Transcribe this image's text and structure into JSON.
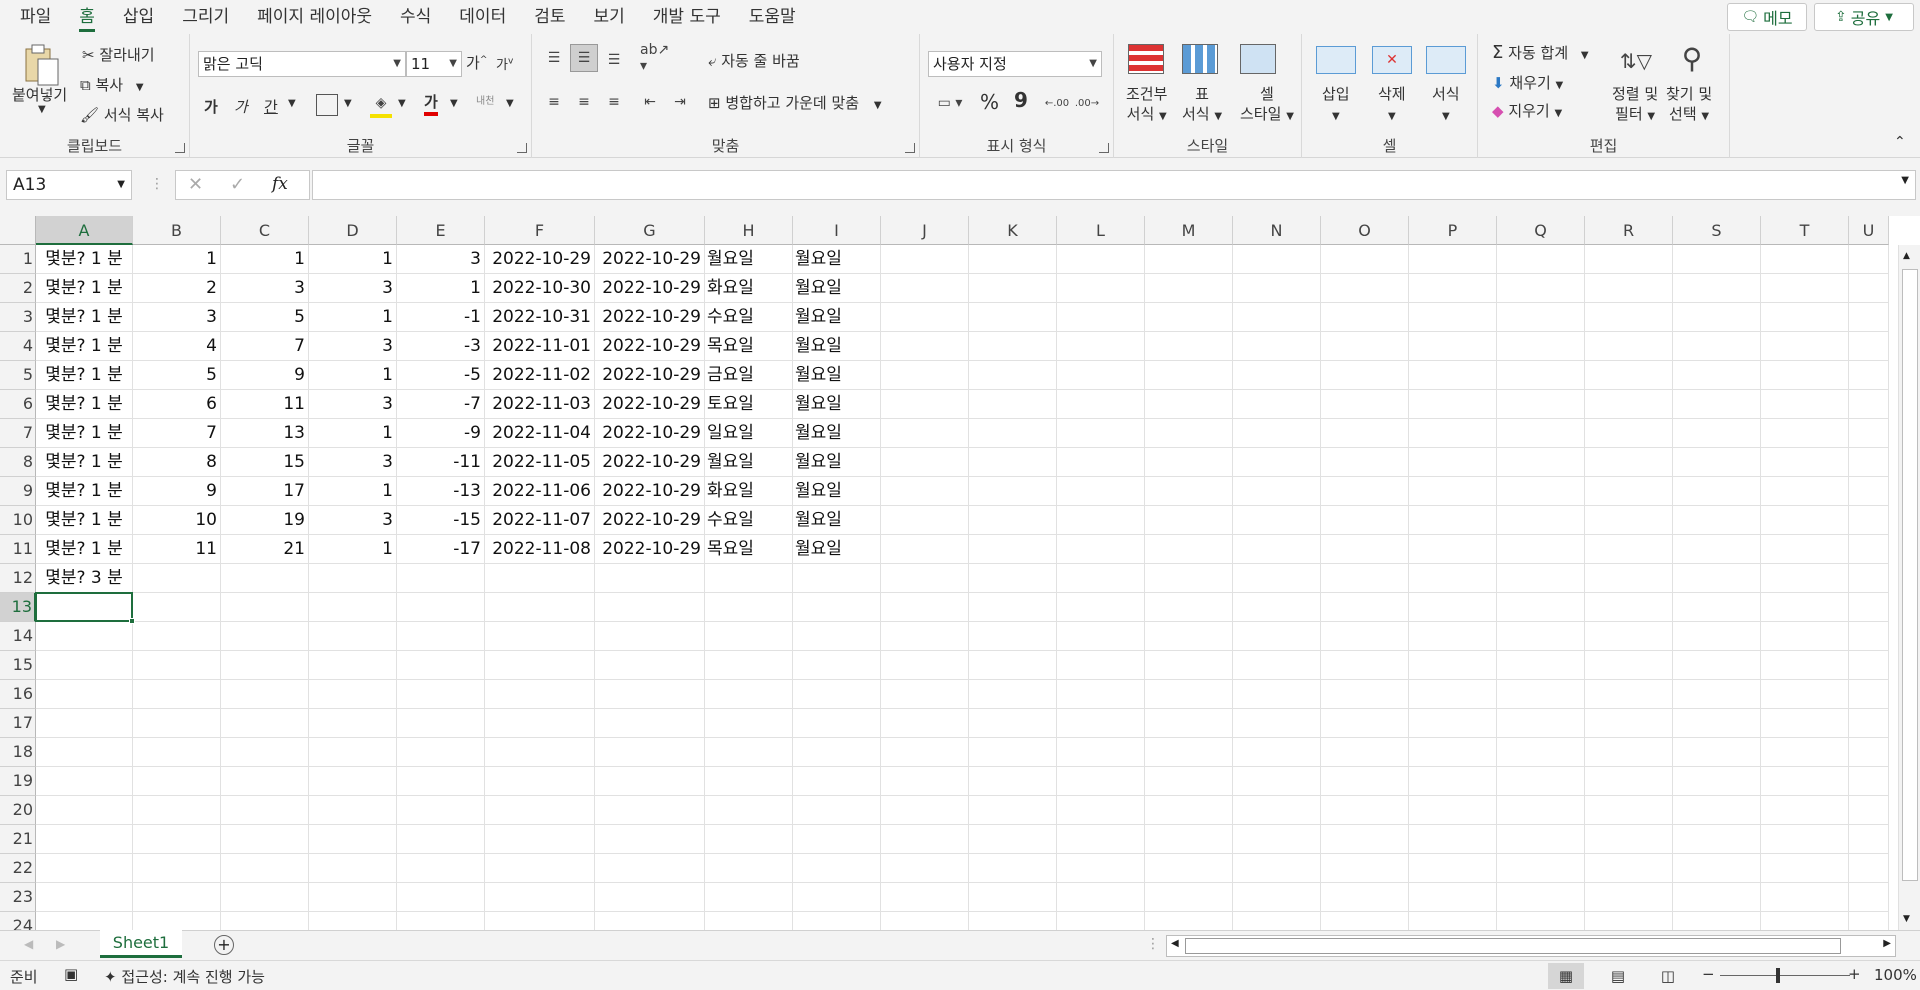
{
  "menu": {
    "tabs": [
      "파일",
      "홈",
      "삽입",
      "그리기",
      "페이지 레이아웃",
      "수식",
      "데이터",
      "검토",
      "보기",
      "개발 도구",
      "도움말"
    ],
    "active_index": 1
  },
  "topright": {
    "memo_label": "메모",
    "share_label": "공유"
  },
  "ribbon": {
    "clipboard": {
      "label": "클립보드",
      "paste": "붙여넣기",
      "cut": "잘라내기",
      "copy": "복사",
      "format_painter": "서식 복사"
    },
    "font": {
      "label": "글꼴",
      "font_name": "맑은 고딕",
      "font_size": "11",
      "grow": "가",
      "shrink": "가",
      "bold": "가",
      "italic": "가",
      "underline": "간",
      "font_color_glyph": "가",
      "phonetic": "내천"
    },
    "alignment": {
      "label": "맞춤",
      "wrap": "자동 줄 바꿈",
      "merge": "병합하고 가운데 맞춤"
    },
    "number": {
      "label": "표시 형식",
      "format": "사용자 지정",
      "percent": "%",
      "comma": "9"
    },
    "styles": {
      "label": "스타일",
      "conditional_line1": "조건부",
      "conditional_line2": "서식",
      "table_line1": "표",
      "table_line2": "서식",
      "cell_line1": "셀",
      "cell_line2": "스타일"
    },
    "cells": {
      "label": "셀",
      "insert": "삽입",
      "delete": "삭제",
      "format": "서식"
    },
    "editing": {
      "label": "편집",
      "autosum": "자동 합계",
      "fill": "채우기",
      "clear": "지우기",
      "sort_line1": "정렬 및",
      "sort_line2": "필터",
      "find_line1": "찾기 및",
      "find_line2": "선택"
    }
  },
  "formula_bar": {
    "name_box": "A13",
    "fx": "fx",
    "formula": ""
  },
  "sheet": {
    "columns": [
      "A",
      "B",
      "C",
      "D",
      "E",
      "F",
      "G",
      "H",
      "I",
      "J",
      "K",
      "L",
      "M",
      "N",
      "O",
      "P",
      "Q",
      "R",
      "S",
      "T",
      "U"
    ],
    "row_count": 24,
    "rows": [
      [
        "몇분? 1 분",
        "1",
        "1",
        "1",
        "3",
        "2022-10-29",
        "2022-10-29",
        "월요일",
        "월요일"
      ],
      [
        "몇분? 1 분",
        "2",
        "3",
        "3",
        "1",
        "2022-10-30",
        "2022-10-29",
        "화요일",
        "월요일"
      ],
      [
        "몇분? 1 분",
        "3",
        "5",
        "1",
        "-1",
        "2022-10-31",
        "2022-10-29",
        "수요일",
        "월요일"
      ],
      [
        "몇분? 1 분",
        "4",
        "7",
        "3",
        "-3",
        "2022-11-01",
        "2022-10-29",
        "목요일",
        "월요일"
      ],
      [
        "몇분? 1 분",
        "5",
        "9",
        "1",
        "-5",
        "2022-11-02",
        "2022-10-29",
        "금요일",
        "월요일"
      ],
      [
        "몇분? 1 분",
        "6",
        "11",
        "3",
        "-7",
        "2022-11-03",
        "2022-10-29",
        "토요일",
        "월요일"
      ],
      [
        "몇분? 1 분",
        "7",
        "13",
        "1",
        "-9",
        "2022-11-04",
        "2022-10-29",
        "일요일",
        "월요일"
      ],
      [
        "몇분? 1 분",
        "8",
        "15",
        "3",
        "-11",
        "2022-11-05",
        "2022-10-29",
        "월요일",
        "월요일"
      ],
      [
        "몇분? 1 분",
        "9",
        "17",
        "1",
        "-13",
        "2022-11-06",
        "2022-10-29",
        "화요일",
        "월요일"
      ],
      [
        "몇분? 1 분",
        "10",
        "19",
        "3",
        "-15",
        "2022-11-07",
        "2022-10-29",
        "수요일",
        "월요일"
      ],
      [
        "몇분? 1 분",
        "11",
        "21",
        "1",
        "-17",
        "2022-11-08",
        "2022-10-29",
        "목요일",
        "월요일"
      ],
      [
        "몇분? 3 분"
      ]
    ],
    "active_cell": "A13"
  },
  "sheet_tabs": [
    "Sheet1"
  ],
  "status": {
    "ready": "준비",
    "accessibility": "접근성: 계속 진행 가능",
    "zoom": "100%"
  },
  "colors": {
    "accent": "#1e6e3d"
  }
}
